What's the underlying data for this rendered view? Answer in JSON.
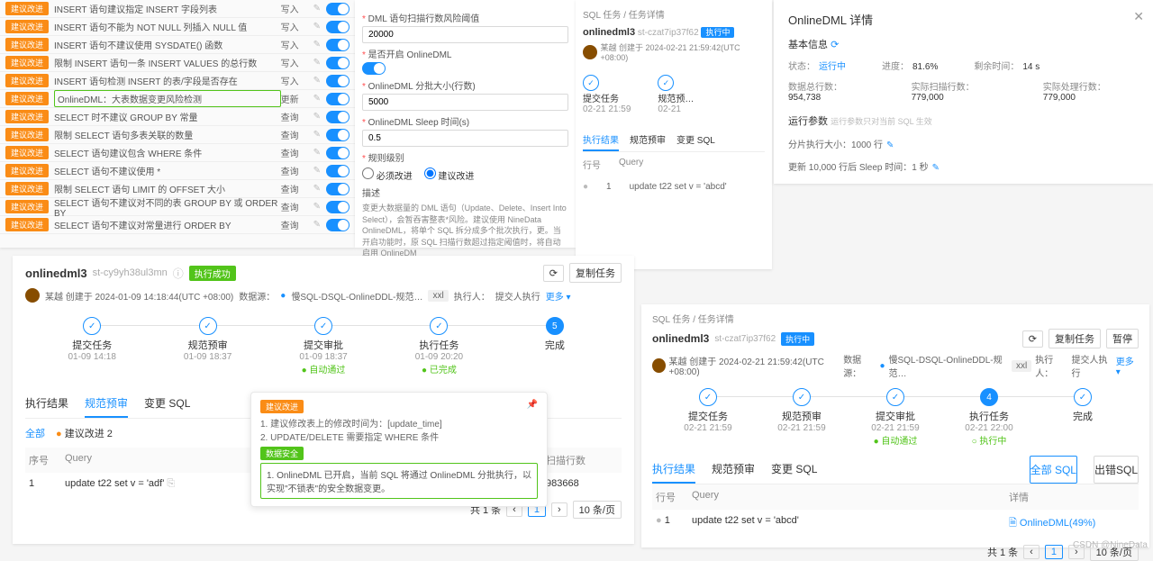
{
  "rules": [
    {
      "name": "INSERT 语句建议指定 INSERT 字段列表",
      "action": "写入"
    },
    {
      "name": "INSERT 语句不能为 NOT NULL 列插入 NULL 值",
      "action": "写入"
    },
    {
      "name": "INSERT 语句不建议使用 SYSDATE() 函数",
      "action": "写入"
    },
    {
      "name": "限制 INSERT 语句一条 INSERT VALUES 的总行数",
      "action": "写入"
    },
    {
      "name": "INSERT 语句检测 INSERT 的表/字段是否存在",
      "action": "写入"
    },
    {
      "name": "OnlineDML：大表数据变更风险检测",
      "action": "更新",
      "green": true
    },
    {
      "name": "SELECT 时不建议 GROUP BY 常量",
      "action": "查询"
    },
    {
      "name": "限制 SELECT 语句多表关联的数量",
      "action": "查询"
    },
    {
      "name": "SELECT 语句建议包含 WHERE 条件",
      "action": "查询"
    },
    {
      "name": "SELECT 语句不建议使用 *",
      "action": "查询"
    },
    {
      "name": "限制 SELECT 语句 LIMIT 的 OFFSET 大小",
      "action": "查询"
    },
    {
      "name": "SELECT 语句不建议对不同的表 GROUP BY 或 ORDER BY",
      "action": "查询"
    },
    {
      "name": "SELECT 语句不建议对常量进行 ORDER BY",
      "action": "查询"
    }
  ],
  "tag_label": "建议改进",
  "settings": {
    "label1": "DML 语句扫描行数风险阈值",
    "val1": "20000",
    "label2": "是否开启 OnlineDML",
    "label3": "OnlineDML 分批大小(行数)",
    "val3": "5000",
    "label4": "OnlineDML Sleep 时间(s)",
    "val4": "0.5",
    "label5": "规则级别",
    "opt1": "必须改进",
    "opt2": "建议改进",
    "desc_h": "描述",
    "desc": "变更大数据量的 DML 语句（Update、Delete、Insert Into Select），会暂吞害整表*风险。建议使用 NineData OnlineDML，将单个 SQL 拆分成多个批次执行，更。当开启功能时，原 SQL 扫描行数超过指定阈值时，将自动启用 OnlineDM"
  },
  "topright": {
    "bc": "SQL 任务 / 任务详情",
    "name": "onlinedml3",
    "id": "st-czat7ip37f62",
    "badge": "执行中",
    "creator": "某越 创建于 2024-02-21 21:59:42(UTC +08:00)",
    "step1": "提交任务",
    "step2": "规范预…",
    "t1": "02-21 21:59",
    "t2": "02-21",
    "tab1": "执行结果",
    "tab2": "规范预审",
    "tab3": "变更 SQL",
    "col1": "行号",
    "col2": "Query",
    "r1": "1",
    "q1": "update t22 set v = 'abcd'"
  },
  "drawer": {
    "title": "OnlineDML 详情",
    "basic": "基本信息",
    "k_status": "状态：",
    "v_status": "运行中",
    "k_prog": "进度：",
    "v_prog": "81.6%",
    "k_remain": "剩余时间：",
    "v_remain": "14 s",
    "k_total": "数据总行数：",
    "v_total": "954,738",
    "k_scan": "实际扫描行数：",
    "v_scan": "779,000",
    "k_proc": "实际处理行数：",
    "v_proc": "779,000",
    "params": "运行参数",
    "params_note": "运行参数只对当前 SQL 生效",
    "p1": "分片执行大小：1000 行",
    "p2": "更新 10,000 行后 Sleep 时间：1 秒"
  },
  "big": {
    "name": "onlinedml3",
    "id": "st-cy9yh38ul3mn",
    "status": "执行成功",
    "refresh": "⟳",
    "copy": "复制任务",
    "creator": "某越 创建于 2024-01-09 14:18:44(UTC +08:00)",
    "ds": "数据源：",
    "ds_v": "慢SQL-DSQL-OnlineDDL-规范…",
    "ds_chip": "xxl",
    "exec": "执行人：",
    "exec_v": "提交人执行",
    "more": "更多 ▾",
    "steps": [
      {
        "l": "提交任务",
        "t": "01-09 14:18"
      },
      {
        "l": "规范预审",
        "t": "01-09 18:37"
      },
      {
        "l": "提交审批",
        "t": "01-09 18:37",
        "s": "● 自动通过"
      },
      {
        "l": "执行任务",
        "t": "01-09 20:20",
        "s": "● 已完成"
      },
      {
        "l": "完成",
        "solid": true
      }
    ],
    "tab1": "执行结果",
    "tab2": "规范预审",
    "tab3": "变更 SQL",
    "f_all": "全部",
    "f_sugg": "建议改进 2",
    "col_n": "序号",
    "col_q": "Query",
    "col_s": "扫描行数",
    "r_n": "1",
    "r_q": "update t22 set v = 'adf'",
    "r_s": "983668",
    "total": "共 1 条",
    "page": "1",
    "per": "10 条/页"
  },
  "callout": {
    "tag1": "建议改进",
    "l1": "1. 建议修改表上的修改时间为：[update_time]",
    "l2": "2. UPDATE/DELETE 需要指定 WHERE 条件",
    "tag2": "数据安全",
    "l3": "1. OnlineDML 已开启，当前 SQL 将通过 OnlineDML 分批执行，以实现\"不锁表\"的安全数据变更。"
  },
  "br": {
    "bc": "SQL 任务 / 任务详情",
    "name": "onlinedml3",
    "id": "st-czat7ip37f62",
    "badge": "执行中",
    "refresh": "⟳",
    "copy": "复制任务",
    "pause": "暂停",
    "creator": "某越 创建于 2024-02-21 21:59:42(UTC +08:00)",
    "ds": "数据源：",
    "ds_v": "慢SQL-DSQL-OnlineDDL-规范…",
    "ds_chip": "xxl",
    "exec": "执行人：",
    "exec_v": "提交人执行",
    "more": "更多 ▾",
    "steps": [
      {
        "l": "提交任务",
        "t": "02-21 21:59"
      },
      {
        "l": "规范预审",
        "t": "02-21 21:59"
      },
      {
        "l": "提交审批",
        "t": "02-21 21:59",
        "s": "● 自动通过"
      },
      {
        "l": "执行任务",
        "t": "02-21 22:00",
        "s": "○ 执行中",
        "solid": true
      },
      {
        "l": "完成"
      }
    ],
    "tab1": "执行结果",
    "tab2": "规范预审",
    "tab3": "变更 SQL",
    "b_all": "全部 SQL",
    "b_err": "出错SQL",
    "col_n": "行号",
    "col_q": "Query",
    "col_d": "详情",
    "r_n": "1",
    "r_q": "update t22 set v = 'abcd'",
    "r_d": "OnlineDML(49%)",
    "total": "共 1 条",
    "page": "1",
    "per": "10 条/页"
  },
  "watermark": "CSDN @NineData"
}
